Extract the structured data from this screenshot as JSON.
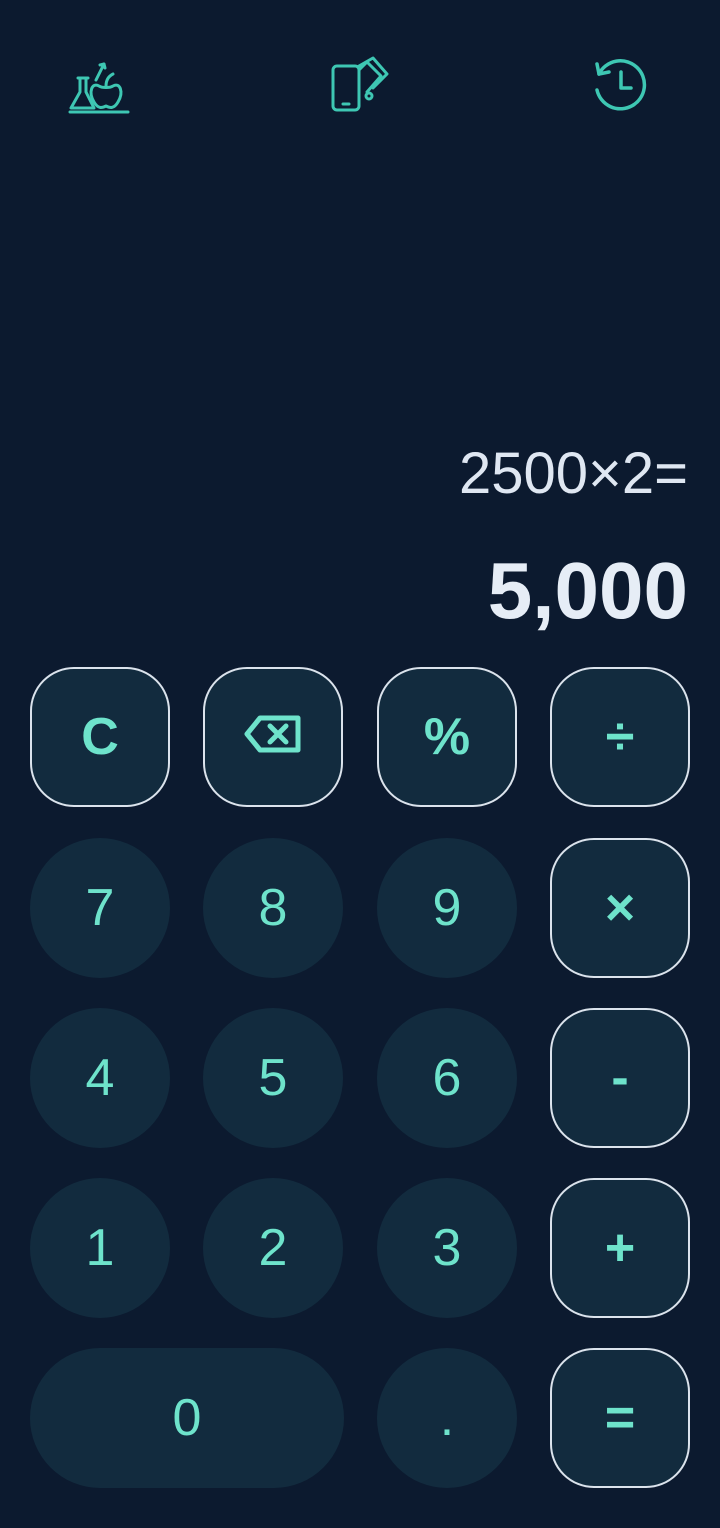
{
  "header": {
    "icons": [
      "science-icon",
      "theme-icon",
      "history-icon"
    ],
    "icon_color": "#3ec7b3"
  },
  "display": {
    "expression": "2500×2=",
    "result": "5,000"
  },
  "keypad": {
    "clear": "C",
    "backspace_icon": "backspace-icon",
    "percent": "%",
    "divide": "÷",
    "seven": "7",
    "eight": "8",
    "nine": "9",
    "multiply": "×",
    "four": "4",
    "five": "5",
    "six": "6",
    "minus": "-",
    "one": "1",
    "two": "2",
    "three": "3",
    "plus": "+",
    "zero": "0",
    "dot": ".",
    "equals": "="
  },
  "colors": {
    "background": "#0c1a2f",
    "key_background": "#122b3e",
    "key_text": "#6ee3cb",
    "key_border": "#dbe3ec",
    "display_text": "#e6edf6"
  }
}
